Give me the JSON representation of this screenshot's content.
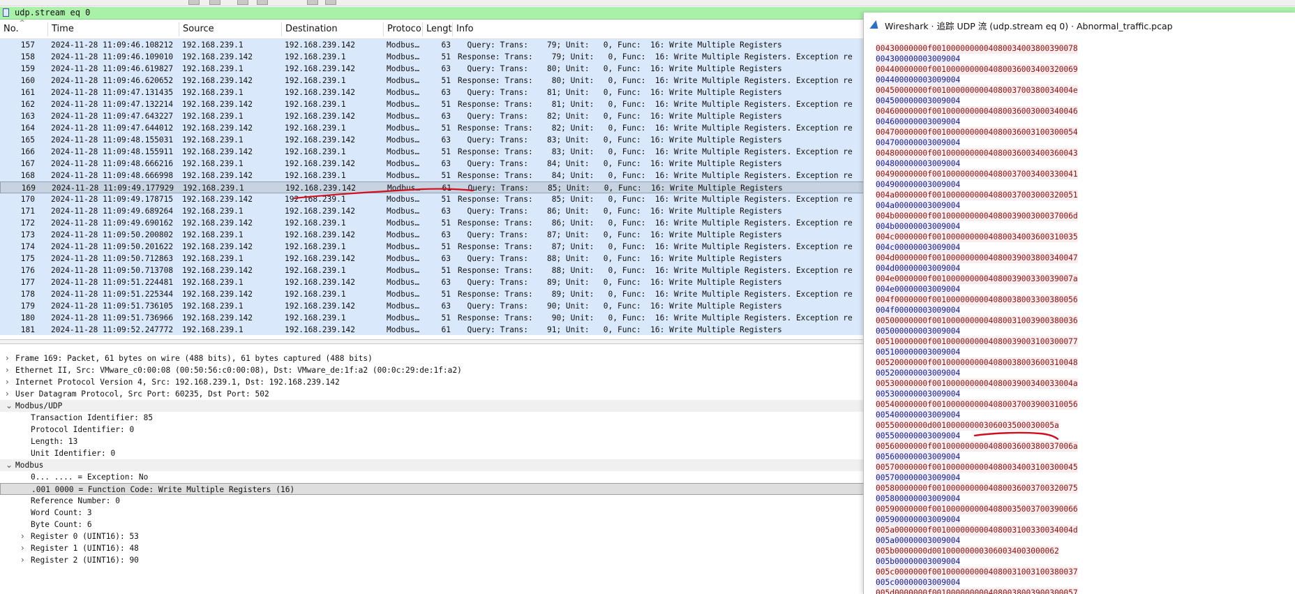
{
  "colors": {
    "filter_bg": "#a9f0a9",
    "row_bg": "#dae8fb",
    "selected_row_bg": "#c7d3e0",
    "client_text": "#8a1010",
    "server_text": "#1a1a8a",
    "annotation_ink": "#d10f1f"
  },
  "filter": {
    "value": "udp.stream eq 0",
    "bookmark_icon": "bookmark-icon"
  },
  "columns": [
    "No.",
    "Time",
    "Source",
    "Destination",
    "Protoco",
    "Lengt",
    "Info"
  ],
  "packets": [
    {
      "no": "157",
      "time": "2024-11-28 11:09:46.108212",
      "src": "192.168.239.1",
      "dst": "192.168.239.142",
      "proto": "Modbus…",
      "len": "63",
      "info": "  Query: Trans:    79; Unit:   0, Func:  16: Write Multiple Registers"
    },
    {
      "no": "158",
      "time": "2024-11-28 11:09:46.109010",
      "src": "192.168.239.142",
      "dst": "192.168.239.1",
      "proto": "Modbus…",
      "len": "51",
      "info": "Response: Trans:    79; Unit:   0, Func:  16: Write Multiple Registers. Exception re"
    },
    {
      "no": "159",
      "time": "2024-11-28 11:09:46.619827",
      "src": "192.168.239.1",
      "dst": "192.168.239.142",
      "proto": "Modbus…",
      "len": "63",
      "info": "  Query: Trans:    80; Unit:   0, Func:  16: Write Multiple Registers"
    },
    {
      "no": "160",
      "time": "2024-11-28 11:09:46.620652",
      "src": "192.168.239.142",
      "dst": "192.168.239.1",
      "proto": "Modbus…",
      "len": "51",
      "info": "Response: Trans:    80; Unit:   0, Func:  16: Write Multiple Registers. Exception re"
    },
    {
      "no": "161",
      "time": "2024-11-28 11:09:47.131435",
      "src": "192.168.239.1",
      "dst": "192.168.239.142",
      "proto": "Modbus…",
      "len": "63",
      "info": "  Query: Trans:    81; Unit:   0, Func:  16: Write Multiple Registers"
    },
    {
      "no": "162",
      "time": "2024-11-28 11:09:47.132214",
      "src": "192.168.239.142",
      "dst": "192.168.239.1",
      "proto": "Modbus…",
      "len": "51",
      "info": "Response: Trans:    81; Unit:   0, Func:  16: Write Multiple Registers. Exception re"
    },
    {
      "no": "163",
      "time": "2024-11-28 11:09:47.643227",
      "src": "192.168.239.1",
      "dst": "192.168.239.142",
      "proto": "Modbus…",
      "len": "63",
      "info": "  Query: Trans:    82; Unit:   0, Func:  16: Write Multiple Registers"
    },
    {
      "no": "164",
      "time": "2024-11-28 11:09:47.644012",
      "src": "192.168.239.142",
      "dst": "192.168.239.1",
      "proto": "Modbus…",
      "len": "51",
      "info": "Response: Trans:    82; Unit:   0, Func:  16: Write Multiple Registers. Exception re"
    },
    {
      "no": "165",
      "time": "2024-11-28 11:09:48.155031",
      "src": "192.168.239.1",
      "dst": "192.168.239.142",
      "proto": "Modbus…",
      "len": "63",
      "info": "  Query: Trans:    83; Unit:   0, Func:  16: Write Multiple Registers"
    },
    {
      "no": "166",
      "time": "2024-11-28 11:09:48.155911",
      "src": "192.168.239.142",
      "dst": "192.168.239.1",
      "proto": "Modbus…",
      "len": "51",
      "info": "Response: Trans:    83; Unit:   0, Func:  16: Write Multiple Registers. Exception re"
    },
    {
      "no": "167",
      "time": "2024-11-28 11:09:48.666216",
      "src": "192.168.239.1",
      "dst": "192.168.239.142",
      "proto": "Modbus…",
      "len": "63",
      "info": "  Query: Trans:    84; Unit:   0, Func:  16: Write Multiple Registers"
    },
    {
      "no": "168",
      "time": "2024-11-28 11:09:48.666998",
      "src": "192.168.239.142",
      "dst": "192.168.239.1",
      "proto": "Modbus…",
      "len": "51",
      "info": "Response: Trans:    84; Unit:   0, Func:  16: Write Multiple Registers. Exception re"
    },
    {
      "no": "169",
      "time": "2024-11-28 11:09:49.177929",
      "src": "192.168.239.1",
      "dst": "192.168.239.142",
      "proto": "Modbus…",
      "len": "61",
      "info": "  Query: Trans:    85; Unit:   0, Func:  16: Write Multiple Registers",
      "selected": true
    },
    {
      "no": "170",
      "time": "2024-11-28 11:09:49.178715",
      "src": "192.168.239.142",
      "dst": "192.168.239.1",
      "proto": "Modbus…",
      "len": "51",
      "info": "Response: Trans:    85; Unit:   0, Func:  16: Write Multiple Registers. Exception re"
    },
    {
      "no": "171",
      "time": "2024-11-28 11:09:49.689264",
      "src": "192.168.239.1",
      "dst": "192.168.239.142",
      "proto": "Modbus…",
      "len": "63",
      "info": "  Query: Trans:    86; Unit:   0, Func:  16: Write Multiple Registers"
    },
    {
      "no": "172",
      "time": "2024-11-28 11:09:49.690162",
      "src": "192.168.239.142",
      "dst": "192.168.239.1",
      "proto": "Modbus…",
      "len": "51",
      "info": "Response: Trans:    86; Unit:   0, Func:  16: Write Multiple Registers. Exception re"
    },
    {
      "no": "173",
      "time": "2024-11-28 11:09:50.200802",
      "src": "192.168.239.1",
      "dst": "192.168.239.142",
      "proto": "Modbus…",
      "len": "63",
      "info": "  Query: Trans:    87; Unit:   0, Func:  16: Write Multiple Registers"
    },
    {
      "no": "174",
      "time": "2024-11-28 11:09:50.201622",
      "src": "192.168.239.142",
      "dst": "192.168.239.1",
      "proto": "Modbus…",
      "len": "51",
      "info": "Response: Trans:    87; Unit:   0, Func:  16: Write Multiple Registers. Exception re"
    },
    {
      "no": "175",
      "time": "2024-11-28 11:09:50.712863",
      "src": "192.168.239.1",
      "dst": "192.168.239.142",
      "proto": "Modbus…",
      "len": "63",
      "info": "  Query: Trans:    88; Unit:   0, Func:  16: Write Multiple Registers"
    },
    {
      "no": "176",
      "time": "2024-11-28 11:09:50.713708",
      "src": "192.168.239.142",
      "dst": "192.168.239.1",
      "proto": "Modbus…",
      "len": "51",
      "info": "Response: Trans:    88; Unit:   0, Func:  16: Write Multiple Registers. Exception re"
    },
    {
      "no": "177",
      "time": "2024-11-28 11:09:51.224481",
      "src": "192.168.239.1",
      "dst": "192.168.239.142",
      "proto": "Modbus…",
      "len": "63",
      "info": "  Query: Trans:    89; Unit:   0, Func:  16: Write Multiple Registers"
    },
    {
      "no": "178",
      "time": "2024-11-28 11:09:51.225344",
      "src": "192.168.239.142",
      "dst": "192.168.239.1",
      "proto": "Modbus…",
      "len": "51",
      "info": "Response: Trans:    89; Unit:   0, Func:  16: Write Multiple Registers. Exception re"
    },
    {
      "no": "179",
      "time": "2024-11-28 11:09:51.736105",
      "src": "192.168.239.1",
      "dst": "192.168.239.142",
      "proto": "Modbus…",
      "len": "63",
      "info": "  Query: Trans:    90; Unit:   0, Func:  16: Write Multiple Registers"
    },
    {
      "no": "180",
      "time": "2024-11-28 11:09:51.736966",
      "src": "192.168.239.142",
      "dst": "192.168.239.1",
      "proto": "Modbus…",
      "len": "51",
      "info": "Response: Trans:    90; Unit:   0, Func:  16: Write Multiple Registers. Exception re"
    },
    {
      "no": "181",
      "time": "2024-11-28 11:09:52.247772",
      "src": "192.168.239.1",
      "dst": "192.168.239.142",
      "proto": "Modbus…",
      "len": "61",
      "info": "  Query: Trans:    91; Unit:   0, Func:  16: Write Multiple Registers"
    }
  ],
  "details": [
    {
      "text": "Frame 169: Packet, 61 bytes on wire (488 bits), 61 bytes captured (488 bits)",
      "indent": 0,
      "arrow": "›"
    },
    {
      "text": "Ethernet II, Src: VMware_c0:00:08 (00:50:56:c0:00:08), Dst: VMware_de:1f:a2 (00:0c:29:de:1f:a2)",
      "indent": 0,
      "arrow": "›"
    },
    {
      "text": "Internet Protocol Version 4, Src: 192.168.239.1, Dst: 192.168.239.142",
      "indent": 0,
      "arrow": "›"
    },
    {
      "text": "User Datagram Protocol, Src Port: 60235, Dst Port: 502",
      "indent": 0,
      "arrow": "›"
    },
    {
      "text": "Modbus/UDP",
      "indent": 0,
      "arrow": "⌄",
      "section": true
    },
    {
      "text": "Transaction Identifier: 85",
      "indent": 1,
      "arrow": ""
    },
    {
      "text": "Protocol Identifier: 0",
      "indent": 1,
      "arrow": ""
    },
    {
      "text": "Length: 13",
      "indent": 1,
      "arrow": ""
    },
    {
      "text": "Unit Identifier: 0",
      "indent": 1,
      "arrow": ""
    },
    {
      "text": "Modbus",
      "indent": 0,
      "arrow": "⌄",
      "section": true
    },
    {
      "text": "0... .... = Exception: No",
      "indent": 1,
      "arrow": ""
    },
    {
      "text": ".001 0000 = Function Code: Write Multiple Registers (16)",
      "indent": 1,
      "arrow": "",
      "highlight": true
    },
    {
      "text": "Reference Number: 0",
      "indent": 1,
      "arrow": ""
    },
    {
      "text": "Word Count: 3",
      "indent": 1,
      "arrow": ""
    },
    {
      "text": "Byte Count: 6",
      "indent": 1,
      "arrow": ""
    },
    {
      "text": "Register 0 (UINT16): 53",
      "indent": 1,
      "arrow": "›"
    },
    {
      "text": "Register 1 (UINT16): 48",
      "indent": 1,
      "arrow": "›"
    },
    {
      "text": "Register 2 (UINT16): 90",
      "indent": 1,
      "arrow": "›"
    }
  ],
  "follow_window": {
    "title": "Wireshark · 追踪 UDP 流 (udp.stream eq 0) · Abnormal_traffic.pcap",
    "icon": "wireshark-fin-icon",
    "stream": [
      {
        "dir": "client",
        "text": "00430000000f0010000000004080034003800390078"
      },
      {
        "dir": "server",
        "text": "004300000003009004"
      },
      {
        "dir": "client",
        "text": "00440000000f0010000000004080036003400320069"
      },
      {
        "dir": "server",
        "text": "004400000003009004"
      },
      {
        "dir": "client",
        "text": "00450000000f001000000000408003700380034004e"
      },
      {
        "dir": "server",
        "text": "004500000003009004"
      },
      {
        "dir": "client",
        "text": "00460000000f0010000000004080036003000340046"
      },
      {
        "dir": "server",
        "text": "004600000003009004"
      },
      {
        "dir": "client",
        "text": "00470000000f0010000000004080036003100300054"
      },
      {
        "dir": "server",
        "text": "004700000003009004"
      },
      {
        "dir": "client",
        "text": "00480000000f0010000000004080036003400360043"
      },
      {
        "dir": "server",
        "text": "004800000003009004"
      },
      {
        "dir": "client",
        "text": "00490000000f0010000000004080037003400330041"
      },
      {
        "dir": "server",
        "text": "004900000003009004"
      },
      {
        "dir": "client",
        "text": "004a0000000f0010000000004080037003000320051"
      },
      {
        "dir": "server",
        "text": "004a00000003009004"
      },
      {
        "dir": "client",
        "text": "004b0000000f001000000000408003900300037006d"
      },
      {
        "dir": "server",
        "text": "004b00000003009004"
      },
      {
        "dir": "client",
        "text": "004c0000000f0010000000004080034003600310035"
      },
      {
        "dir": "server",
        "text": "004c00000003009004"
      },
      {
        "dir": "client",
        "text": "004d0000000f0010000000004080039003800340047"
      },
      {
        "dir": "server",
        "text": "004d00000003009004"
      },
      {
        "dir": "client",
        "text": "004e0000000f001000000000408003900330039007a"
      },
      {
        "dir": "server",
        "text": "004e00000003009004"
      },
      {
        "dir": "client",
        "text": "004f0000000f0010000000004080038003300380056"
      },
      {
        "dir": "server",
        "text": "004f00000003009004"
      },
      {
        "dir": "client",
        "text": "00500000000f0010000000004080031003900380036"
      },
      {
        "dir": "server",
        "text": "005000000003009004"
      },
      {
        "dir": "client",
        "text": "00510000000f0010000000004080039003100300077"
      },
      {
        "dir": "server",
        "text": "005100000003009004"
      },
      {
        "dir": "client",
        "text": "00520000000f0010000000004080038003600310048"
      },
      {
        "dir": "server",
        "text": "005200000003009004"
      },
      {
        "dir": "client",
        "text": "00530000000f001000000000408003900340033004a"
      },
      {
        "dir": "server",
        "text": "005300000003009004"
      },
      {
        "dir": "client",
        "text": "00540000000f0010000000004080037003900310056"
      },
      {
        "dir": "server",
        "text": "005400000003009004"
      },
      {
        "dir": "client",
        "text": "00550000000d00100000000306003500030005a"
      },
      {
        "dir": "server",
        "text": "005500000003009004"
      },
      {
        "dir": "client",
        "text": "00560000000f001000000000408003600380037006a"
      },
      {
        "dir": "server",
        "text": "005600000003009004"
      },
      {
        "dir": "client",
        "text": "00570000000f0010000000004080034003100300045"
      },
      {
        "dir": "server",
        "text": "005700000003009004"
      },
      {
        "dir": "client",
        "text": "00580000000f0010000000004080036003700320075"
      },
      {
        "dir": "server",
        "text": "005800000003009004"
      },
      {
        "dir": "client",
        "text": "00590000000f0010000000004080035003700390066"
      },
      {
        "dir": "server",
        "text": "005900000003009004"
      },
      {
        "dir": "client",
        "text": "005a0000000f001000000000408003100330034004d"
      },
      {
        "dir": "server",
        "text": "005a00000003009004"
      },
      {
        "dir": "client",
        "text": "005b0000000d001000000003060034003000062"
      },
      {
        "dir": "server",
        "text": "005b00000003009004"
      },
      {
        "dir": "client",
        "text": "005c0000000f0010000000004080031003100380037"
      },
      {
        "dir": "server",
        "text": "005c00000003009004"
      },
      {
        "dir": "client",
        "text": "005d0000000f0010000000004080038003900300057"
      }
    ]
  }
}
